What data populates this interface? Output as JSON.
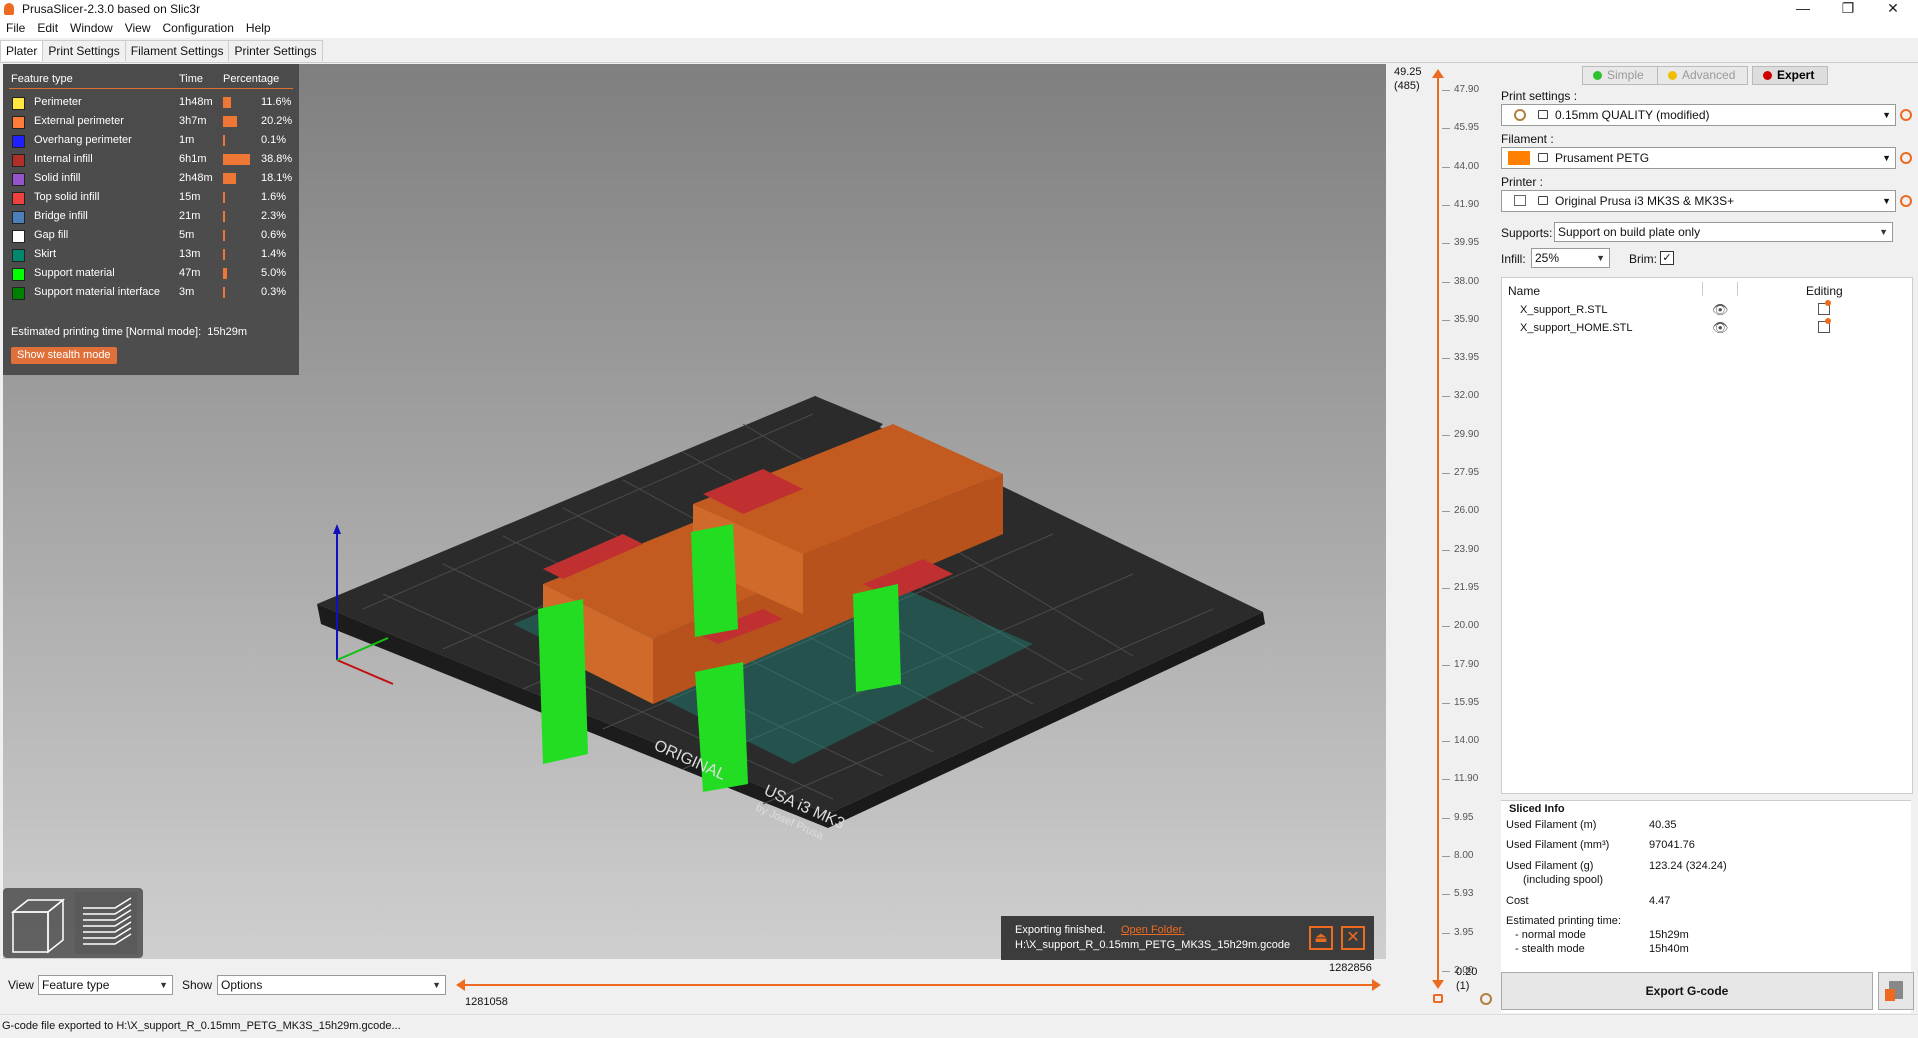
{
  "window": {
    "title": "PrusaSlicer-2.3.0 based on Slic3r",
    "minimize": "—",
    "maximize": "❐",
    "close": "✕"
  },
  "menu": [
    "File",
    "Edit",
    "Window",
    "View",
    "Configuration",
    "Help"
  ],
  "tabs": [
    "Plater",
    "Print Settings",
    "Filament Settings",
    "Printer Settings"
  ],
  "legend": {
    "headers": {
      "feature": "Feature type",
      "time": "Time",
      "percentage": "Percentage"
    },
    "rows": [
      {
        "name": "Perimeter",
        "time": "1h48m",
        "pct": "11.6%",
        "color": "#ffe640",
        "frac": 0.116
      },
      {
        "name": "External perimeter",
        "time": "3h7m",
        "pct": "20.2%",
        "color": "#ff7d38",
        "frac": 0.202
      },
      {
        "name": "Overhang perimeter",
        "time": "1m",
        "pct": "0.1%",
        "color": "#1f1fff",
        "frac": 0.001
      },
      {
        "name": "Internal infill",
        "time": "6h1m",
        "pct": "38.8%",
        "color": "#b03029",
        "frac": 0.388
      },
      {
        "name": "Solid infill",
        "time": "2h48m",
        "pct": "18.1%",
        "color": "#9654cc",
        "frac": 0.181
      },
      {
        "name": "Top solid infill",
        "time": "15m",
        "pct": "1.6%",
        "color": "#f04040",
        "frac": 0.016
      },
      {
        "name": "Bridge infill",
        "time": "21m",
        "pct": "2.3%",
        "color": "#4d80ba",
        "frac": 0.023
      },
      {
        "name": "Gap fill",
        "time": "5m",
        "pct": "0.6%",
        "color": "#ffffff",
        "frac": 0.006
      },
      {
        "name": "Skirt",
        "time": "13m",
        "pct": "1.4%",
        "color": "#00876e",
        "frac": 0.014
      },
      {
        "name": "Support material",
        "time": "47m",
        "pct": "5.0%",
        "color": "#00ff00",
        "frac": 0.05
      },
      {
        "name": "Support material interface",
        "time": "3m",
        "pct": "0.3%",
        "color": "#008000",
        "frac": 0.003
      }
    ],
    "estimated_label": "Estimated printing time [Normal mode]:",
    "estimated_value": "15h29m",
    "stealth_button": "Show stealth mode"
  },
  "bed": {
    "text1": "ORIGINAL",
    "text2": "USA i3 MK3",
    "text3": "by Josef Prusa"
  },
  "notification": {
    "message": "Exporting finished.",
    "link": "Open Folder.",
    "path": "H:\\X_support_R_0.15mm_PETG_MK3S_15h29m.gcode"
  },
  "bottom": {
    "view_label": "View",
    "view_value": "Feature type",
    "show_label": "Show",
    "show_value": "Options",
    "slider_right": "1282856",
    "slider_left": "1281058"
  },
  "vslider": {
    "top_value": "49.25",
    "top_layer": "(485)",
    "bottom_value": "0.20",
    "bottom_layer": "(1)",
    "ticks": [
      "47.90",
      "45.95",
      "44.00",
      "41.90",
      "39.95",
      "38.00",
      "35.90",
      "33.95",
      "32.00",
      "29.90",
      "27.95",
      "26.00",
      "23.90",
      "21.95",
      "20.00",
      "17.90",
      "15.95",
      "14.00",
      "11.90",
      "9.95",
      "8.00",
      "5.93",
      "3.95",
      "2.00"
    ]
  },
  "modes": {
    "simple": "Simple",
    "advanced": "Advanced",
    "expert": "Expert"
  },
  "settings": {
    "print_label": "Print settings :",
    "print_value": "0.15mm QUALITY (modified)",
    "filament_label": "Filament :",
    "filament_value": "Prusament PETG",
    "filament_color": "#ff8000",
    "printer_label": "Printer :",
    "printer_value": "Original Prusa i3 MK3S & MK3S+",
    "supports_label": "Supports:",
    "supports_value": "Support on build plate only",
    "infill_label": "Infill:",
    "infill_value": "25%",
    "brim_label": "Brim:"
  },
  "objects": {
    "col_name": "Name",
    "col_editing": "Editing",
    "items": [
      "X_support_R.STL",
      "X_support_HOME.STL"
    ]
  },
  "sliced_info": {
    "title": "Sliced Info",
    "used_m_label": "Used Filament (m)",
    "used_m": "40.35",
    "used_mm3_label": "Used Filament (mm³)",
    "used_mm3": "97041.76",
    "used_g_label": "Used Filament (g)",
    "used_g_sub": "(including spool)",
    "used_g": "123.24 (324.24)",
    "cost_label": "Cost",
    "cost": "4.47",
    "est_label": "Estimated printing time:",
    "normal_label": "- normal mode",
    "normal": "15h29m",
    "stealth_label": "- stealth mode",
    "stealth": "15h40m"
  },
  "export_button": "Export G-code",
  "status": "G-code file exported to H:\\X_support_R_0.15mm_PETG_MK3S_15h29m.gcode..."
}
